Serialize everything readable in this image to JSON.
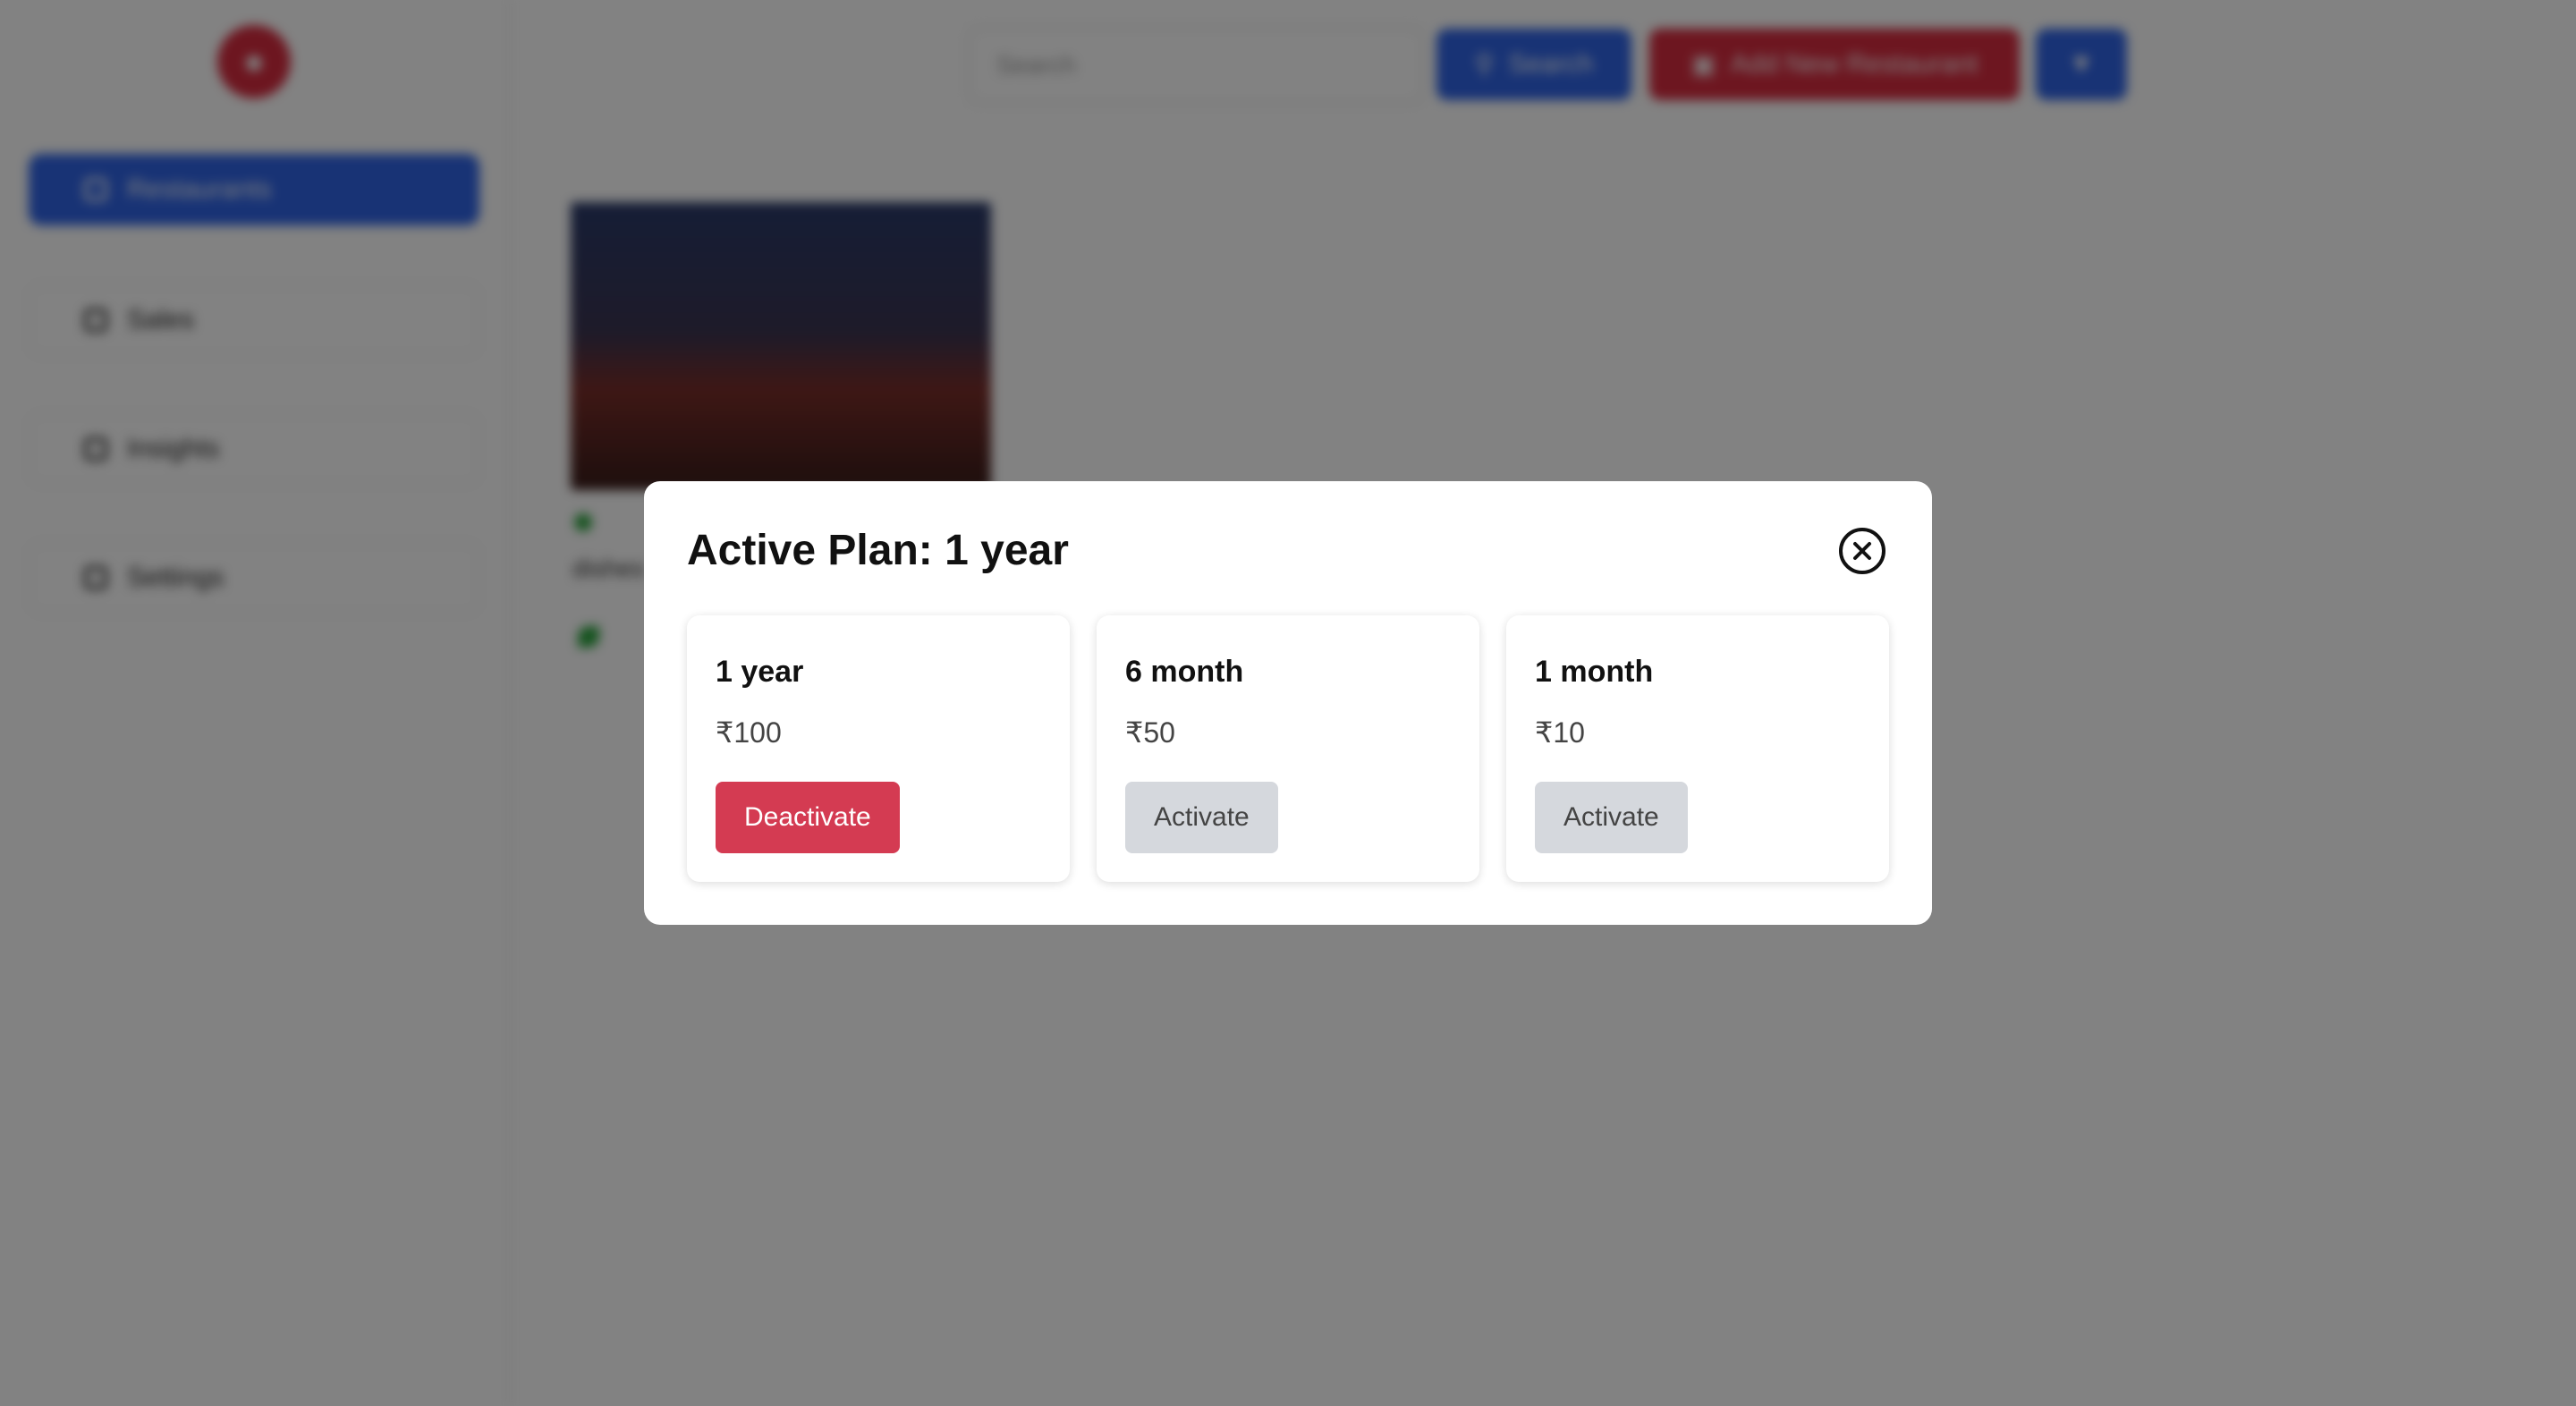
{
  "background": {
    "nav": [
      {
        "label": "Restaurants",
        "active": true
      },
      {
        "label": "Sales",
        "active": false
      },
      {
        "label": "Insights",
        "active": false
      },
      {
        "label": "Settings",
        "active": false
      }
    ],
    "search_placeholder": "Search",
    "search_button": "Search",
    "add_button": "Add New Restaurant",
    "restaurant_name": "dishes"
  },
  "modal": {
    "title": "Active Plan: 1 year",
    "plans": [
      {
        "name": "1 year",
        "price": "₹100",
        "action": "Deactivate"
      },
      {
        "name": "6 month",
        "price": "₹50",
        "action": "Activate"
      },
      {
        "name": "1 month",
        "price": "₹10",
        "action": "Activate"
      }
    ]
  },
  "colors": {
    "primary": "#2f64e6",
    "danger": "#d43b52",
    "neutral_button": "#d5d8dd",
    "overlay": "rgba(0,0,0,0.49)"
  },
  "icons": [
    "app-logo-icon",
    "close-icon",
    "search-icon",
    "plus-icon",
    "filter-icon"
  ]
}
